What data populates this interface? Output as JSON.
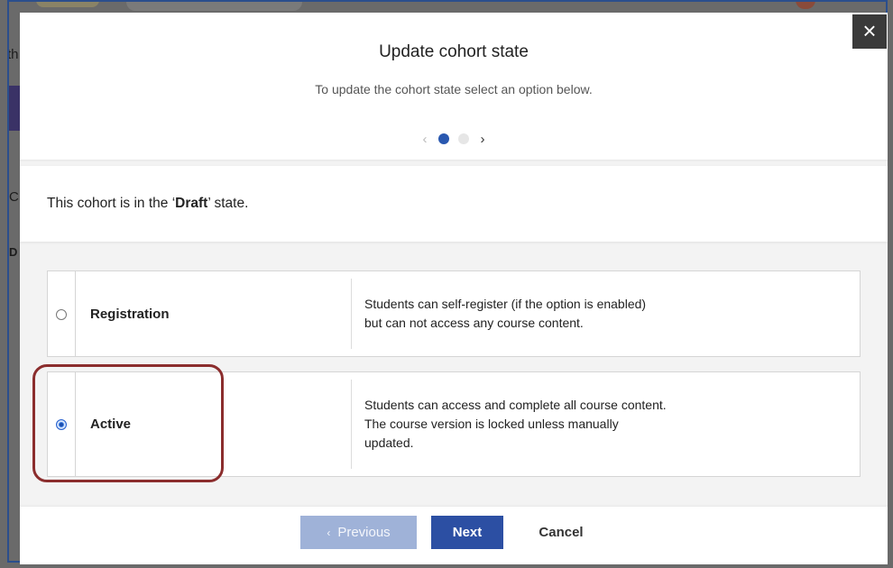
{
  "modal": {
    "title": "Update cohort state",
    "subtitle": "To update the cohort state select an option below.",
    "stepper": {
      "prev_symbol": "‹",
      "next_symbol": "›"
    },
    "state_prefix": "This cohort is in the ‘",
    "state_value": "Draft",
    "state_suffix": "’ state.",
    "close_symbol": "×"
  },
  "options": [
    {
      "label": "Registration",
      "description": "Students can self-register (if the option is enabled)\nbut can not access any course content.",
      "selected": false
    },
    {
      "label": "Active",
      "description": "Students can access and complete all course content.\nThe course version is locked unless manually\nupdated.",
      "selected": true
    }
  ],
  "footer": {
    "previous_label": "Previous",
    "previous_symbol": "‹",
    "next_label": "Next",
    "cancel_label": "Cancel"
  },
  "background": {
    "fragment_1": "th",
    "fragment_2": "C",
    "fragment_3": "D"
  },
  "colors": {
    "primary": "#2c4fa3",
    "primary_disabled": "#9fb2d8",
    "highlight": "#8b2d2d",
    "radio_checked": "#3b7de0"
  }
}
